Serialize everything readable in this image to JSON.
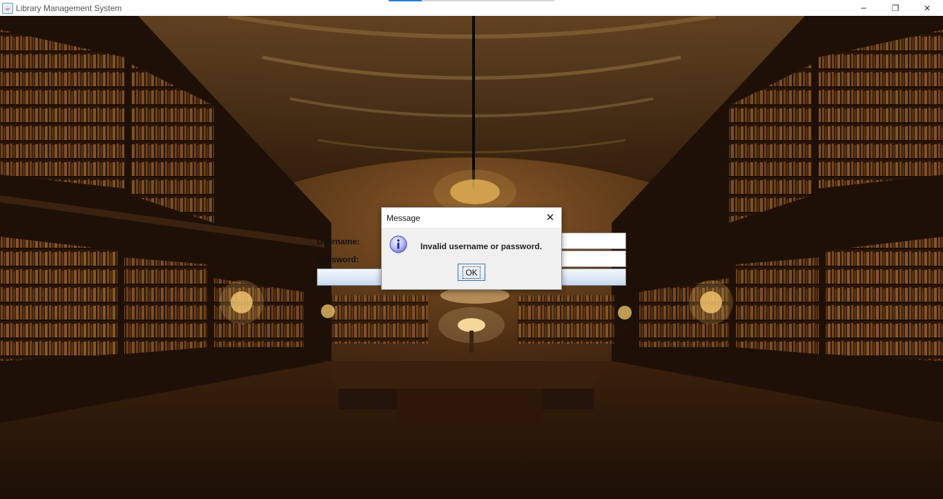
{
  "window": {
    "title": "Library Management System",
    "app_icon_glyph": "☕",
    "controls": {
      "minimize": "─",
      "restore": "❐",
      "close": "✕"
    }
  },
  "background": {
    "description_icon": "library-hall-image"
  },
  "login": {
    "username_label": "Username:",
    "password_label": "Password:",
    "username_value": "",
    "password_value": "",
    "login_button_label": ""
  },
  "dialog": {
    "title": "Message",
    "close_glyph": "✕",
    "icon": "info-icon",
    "message": "Invalid username or password.",
    "ok_label": "OK"
  },
  "colors": {
    "accent": "#2b7bd8",
    "dialog_bg": "#f0f0f0",
    "info_icon": "#6b6fd8"
  }
}
